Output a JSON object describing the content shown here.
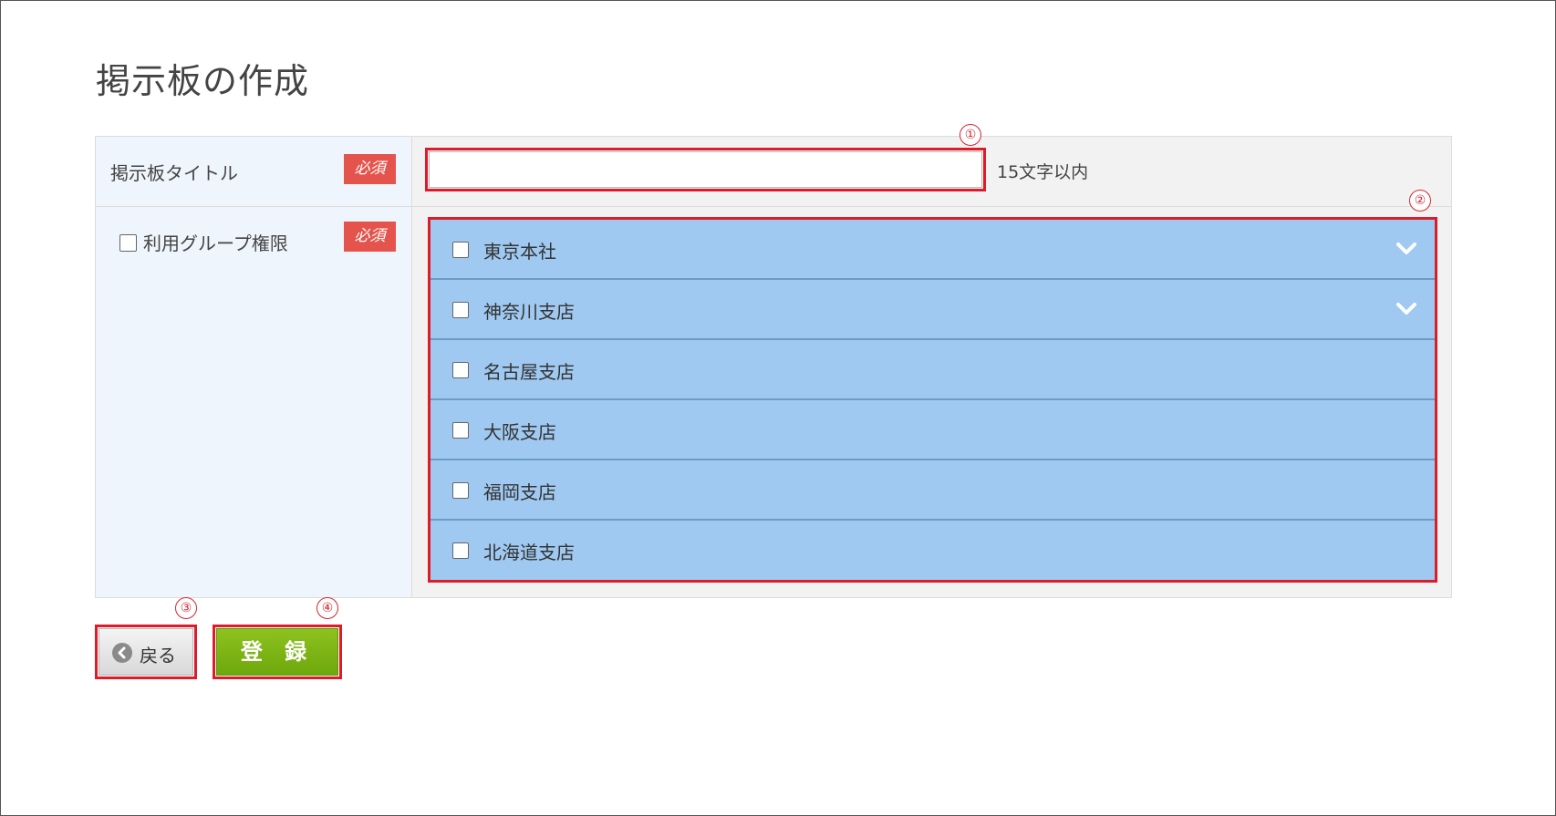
{
  "page": {
    "title": "掲示板の作成"
  },
  "form": {
    "title_row": {
      "label": "掲示板タイトル",
      "required": "必須",
      "input_value": "",
      "input_placeholder": "",
      "hint": "15文字以内"
    },
    "group_row": {
      "label": "利用グループ権限",
      "required": "必須",
      "checked": false,
      "groups": [
        {
          "label": "東京本社",
          "checked": false,
          "expandable": true
        },
        {
          "label": "神奈川支店",
          "checked": false,
          "expandable": true
        },
        {
          "label": "名古屋支店",
          "checked": false,
          "expandable": false
        },
        {
          "label": "大阪支店",
          "checked": false,
          "expandable": false
        },
        {
          "label": "福岡支店",
          "checked": false,
          "expandable": false
        },
        {
          "label": "北海道支店",
          "checked": false,
          "expandable": false
        }
      ]
    }
  },
  "buttons": {
    "back": "戻る",
    "submit": "登 録"
  },
  "markers": [
    "①",
    "②",
    "③",
    "④"
  ],
  "colors": {
    "highlight": "#dd1c2a",
    "required_badge": "#e4544c",
    "group_bg": "#9fc9f1",
    "submit": "#7fb817"
  },
  "icons": {
    "expand": "chevron-down-icon",
    "back": "chevron-left-icon"
  }
}
